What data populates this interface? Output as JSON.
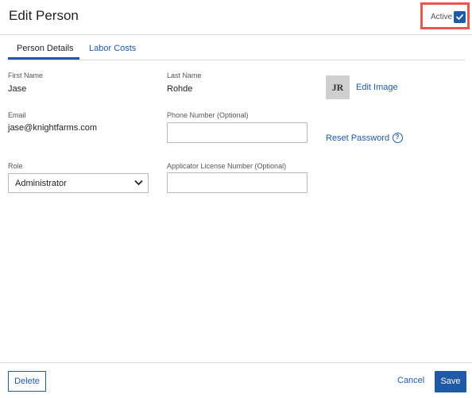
{
  "header": {
    "title": "Edit Person",
    "active_label": "Active",
    "active_checked": true
  },
  "tabs": [
    {
      "label": "Person Details",
      "active": true
    },
    {
      "label": "Labor Costs",
      "active": false
    }
  ],
  "fields": {
    "first_name": {
      "label": "First Name",
      "value": "Jase"
    },
    "last_name": {
      "label": "Last Name",
      "value": "Rohde"
    },
    "email": {
      "label": "Email",
      "value": "jase@knightfarms.com"
    },
    "phone": {
      "label": "Phone Number (Optional)",
      "value": ""
    },
    "role": {
      "label": "Role",
      "value": "Administrator"
    },
    "license": {
      "label": "Applicator License Number (Optional)",
      "value": ""
    }
  },
  "avatar": {
    "initials": "JR",
    "edit_label": "Edit Image"
  },
  "reset_password_label": "Reset Password",
  "help_glyph": "?",
  "footer": {
    "delete_label": "Delete",
    "cancel_label": "Cancel",
    "save_label": "Save"
  },
  "colors": {
    "accent": "#1f5aa6",
    "highlight_border": "#e8574d"
  }
}
